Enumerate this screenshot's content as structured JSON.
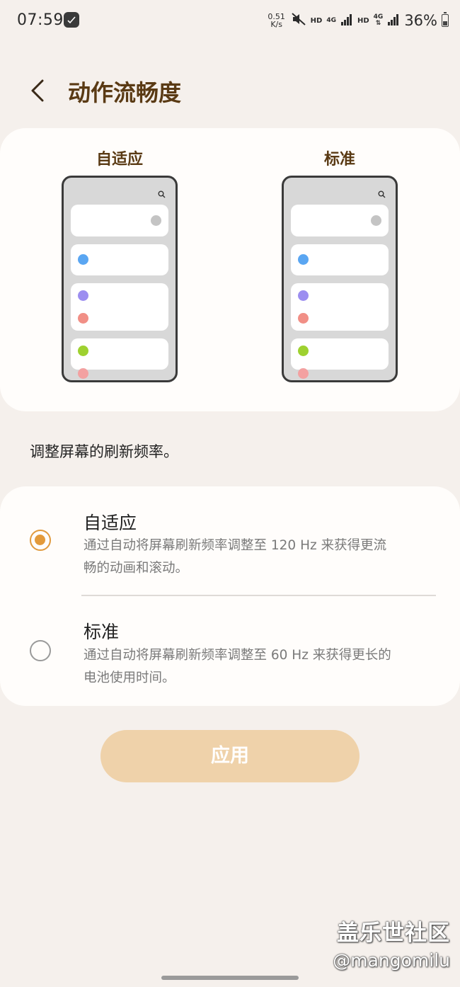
{
  "status_bar": {
    "time": "07:59",
    "net_speed_value": "0.51",
    "net_speed_unit": "K/s",
    "hd_1": "HD",
    "lte_1": "4G",
    "hd_2": "HD",
    "lte_2": "4G",
    "battery_percent": "36%",
    "battery_level": 0.36
  },
  "header": {
    "title": "动作流畅度"
  },
  "preview": {
    "adaptive_label": "自适应",
    "standard_label": "标准",
    "dot_colors": [
      "#c4c4c4",
      "#5aa6f2",
      "#9c8ef0",
      "#f18f86",
      "#9ed130",
      "#f3a1a1"
    ]
  },
  "description": "调整屏幕的刷新频率。",
  "options": [
    {
      "title": "自适应",
      "desc_line1": "通过自动将屏幕刷新频率调整至 120 Hz 来获得更流",
      "desc_line2": "畅的动画和滚动。",
      "selected": true
    },
    {
      "title": "标准",
      "desc_line1": "通过自动将屏幕刷新频率调整至 60 Hz 来获得更长的",
      "desc_line2": "电池使用时间。",
      "selected": false
    }
  ],
  "apply_label": "应用",
  "watermark": {
    "title": "盖乐世社区",
    "handle": "@mangomilu"
  },
  "colors": {
    "accent": "#e39a3a",
    "title_brown": "#5a3a14",
    "button_disabled": "#efd2aa"
  }
}
